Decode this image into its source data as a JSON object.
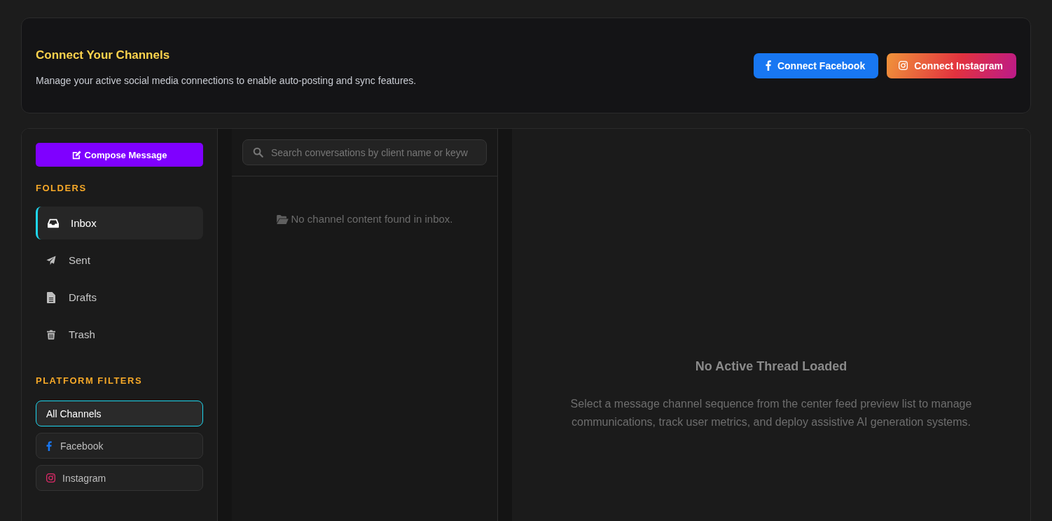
{
  "header": {
    "title": "Connect Your Channels",
    "subtitle": "Manage your active social media connections to enable auto-posting and sync features.",
    "buttons": [
      {
        "kind": "facebook",
        "label": "Connect Facebook"
      },
      {
        "kind": "instagram",
        "label": "Connect Instagram"
      }
    ]
  },
  "sidebar": {
    "compose_button": {
      "label": "Compose Message"
    },
    "folders_heading": "FOLDERS",
    "folders": [
      {
        "kind": "inbox",
        "label": "Inbox",
        "selected": true
      },
      {
        "kind": "sent",
        "label": "Sent",
        "selected": false
      },
      {
        "kind": "drafts",
        "label": "Drafts",
        "selected": false
      },
      {
        "kind": "trash",
        "label": "Trash",
        "selected": false
      }
    ],
    "filters_heading": "PLATFORM FILTERS",
    "filters": [
      {
        "kind": "all",
        "label": "All Channels",
        "selected": true
      },
      {
        "kind": "facebook",
        "label": "Facebook",
        "selected": false
      },
      {
        "kind": "instagram",
        "label": "Instagram",
        "selected": false
      }
    ]
  },
  "conversation_list": {
    "search": {
      "placeholder": "Search conversations by client name or keyw"
    },
    "empty_message": "No channel content found in inbox."
  },
  "thread_panel": {
    "title": "No Active Thread Loaded",
    "description": "Select a message channel sequence from the center feed preview list to manage communications, track user metrics, and deploy assistive AI generation systems."
  }
}
